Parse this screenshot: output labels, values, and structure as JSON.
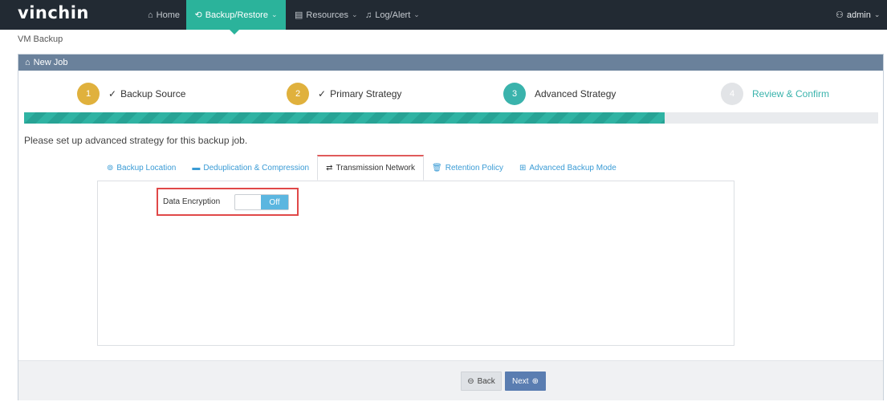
{
  "app": {
    "logo": "vinchin"
  },
  "nav": {
    "home": "Home",
    "backup_restore": "Backup/Restore",
    "resources": "Resources",
    "log_alert": "Log/Alert",
    "user": "admin"
  },
  "breadcrumb": "VM Backup",
  "panel": {
    "title": "New Job"
  },
  "steps": [
    {
      "num": "1",
      "label": "Backup Source",
      "state": "done"
    },
    {
      "num": "2",
      "label": "Primary Strategy",
      "state": "done"
    },
    {
      "num": "3",
      "label": "Advanced Strategy",
      "state": "current"
    },
    {
      "num": "4",
      "label": "Review & Confirm",
      "state": "pending"
    }
  ],
  "progress": {
    "fraction": 0.75
  },
  "prompt": "Please set up advanced strategy for this backup job.",
  "tabs": [
    {
      "label": "Backup Location",
      "icon": "location-icon"
    },
    {
      "label": "Deduplication & Compression",
      "icon": "compress-icon"
    },
    {
      "label": "Transmission Network",
      "icon": "transfer-icon",
      "active": true
    },
    {
      "label": "Retention Policy",
      "icon": "trash-icon"
    },
    {
      "label": "Advanced Backup Mode",
      "icon": "grid-icon"
    }
  ],
  "encryption": {
    "label": "Data Encryption",
    "state": "Off"
  },
  "buttons": {
    "back": "Back",
    "next": "Next"
  },
  "colors": {
    "accent": "#2bb39b",
    "panel_header": "#6a819b",
    "step_done": "#e0b13d",
    "step_current": "#3ab3ac",
    "highlight": "#e04848"
  }
}
